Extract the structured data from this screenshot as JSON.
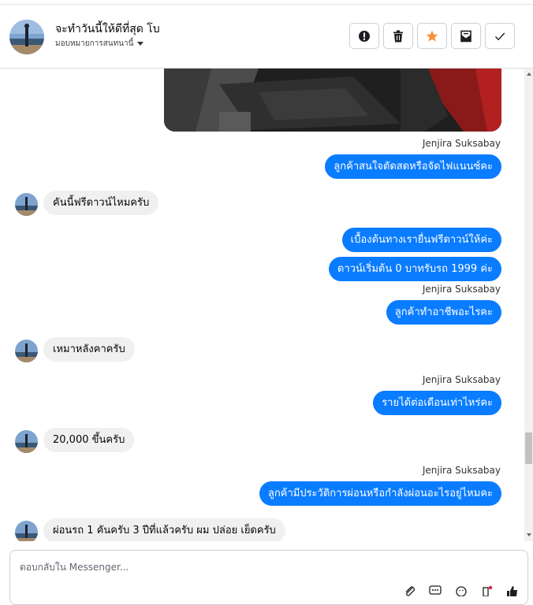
{
  "header": {
    "contact_name": "จะทำวันนี้ให้ดีที่สุด โบ",
    "assign_label": "มอบหมายการสนทนานี้",
    "tools": [
      {
        "icon": "alert-icon",
        "name": "mark-spam-button"
      },
      {
        "icon": "trash-icon",
        "name": "delete-button"
      },
      {
        "icon": "star-icon",
        "name": "star-button"
      },
      {
        "icon": "mail-unread-icon",
        "name": "mark-unread-button"
      },
      {
        "icon": "check-icon",
        "name": "mark-done-button"
      }
    ],
    "star_color": "#f7923b"
  },
  "thread": {
    "messages": [
      {
        "kind": "out",
        "sender": "Jenjira Suksabay",
        "text": "ลูกค้าสนใจตัดสดหรือจัดไฟแนนซ์คะ"
      },
      {
        "kind": "in",
        "text": "คันนี้ฟรีดาวน์ไหมครับ"
      },
      {
        "kind": "out",
        "text": "เบื้องต้นทางเรายื่นฟรีดาวน์ให้ค่ะ"
      },
      {
        "kind": "out",
        "text": "ดาวน์เริ่มต้น 0 บาทรับรถ 1999 ค่ะ"
      },
      {
        "kind": "out",
        "sender": "Jenjira Suksabay",
        "text": "ลูกค้าทำอาชีพอะไรคะ"
      },
      {
        "kind": "in",
        "text": "เหมาหลังคาครับ"
      },
      {
        "kind": "out",
        "sender": "Jenjira Suksabay",
        "text": "รายได้ต่อเดือนเท่าไหร่คะ"
      },
      {
        "kind": "in",
        "text": "20,000 ขึ้นครับ"
      },
      {
        "kind": "out",
        "sender": "Jenjira Suksabay",
        "text": "ลูกค้ามีประวัติการผ่อนหรือกำลังผ่อนอะไรอยู่ไหมคะ"
      },
      {
        "kind": "in",
        "text": "ผ่อนรถ 1 คันครับ 3 ปีที่แล้วครับ ผม ปล่อย เย็ดครับ"
      }
    ],
    "outgoing_color": "#0a7cff",
    "incoming_color": "#f0f0f0"
  },
  "composer": {
    "placeholder": "ตอบกลับใน Messenger...",
    "value": "",
    "icons": [
      "attach-icon",
      "saved-replies-icon",
      "emoji-icon",
      "sticker-icon",
      "like-icon"
    ]
  }
}
